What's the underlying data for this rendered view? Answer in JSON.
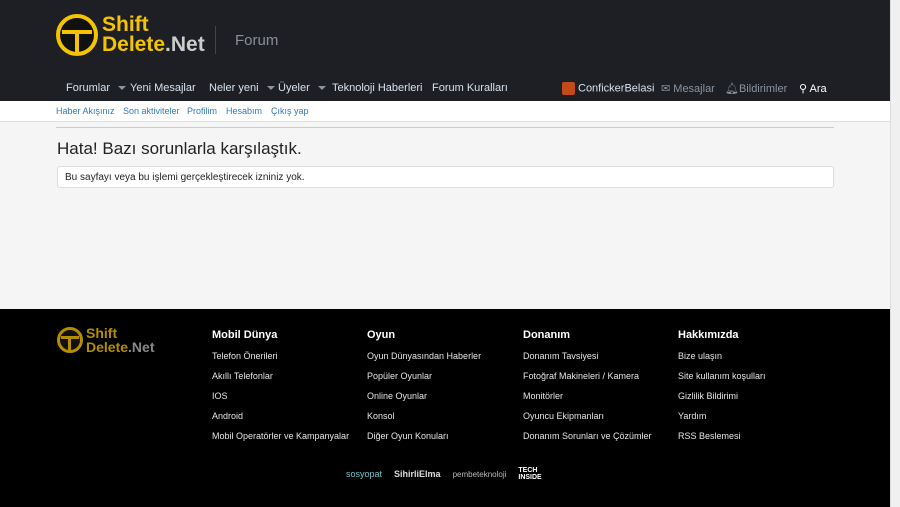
{
  "header": {
    "logo_line1": "Shift",
    "logo_line2": "Delete",
    "logo_line3": ".Net",
    "section": "Forum"
  },
  "nav": {
    "items": [
      {
        "label": "Forumlar"
      },
      {
        "label": "Yeni Mesajlar"
      },
      {
        "label": "Neler yeni"
      },
      {
        "label": "Üyeler"
      },
      {
        "label": "Teknoloji Haberleri"
      },
      {
        "label": "Forum Kuralları"
      }
    ],
    "user": "ConfickerBelasi",
    "messages": "Mesajlar",
    "alerts": "Bildirimler",
    "search": "Ara"
  },
  "subnav": [
    "Haber Akışınız",
    "Son aktiviteler",
    "Profilim",
    "Hesabım",
    "Çıkış yap"
  ],
  "main": {
    "title": "Hata! Bazı sorunlarla karşılaştık.",
    "error": "Bu sayfayı veya bu işlemi gerçekleştirecek izniniz yok."
  },
  "footer": {
    "columns": [
      {
        "title": "Mobil Dünya",
        "links": [
          "Telefon Önerileri",
          "Akıllı Telefonlar",
          "IOS",
          "Android",
          "Mobil Operatörler ve Kampanyalar"
        ]
      },
      {
        "title": "Oyun",
        "links": [
          "Oyun Dünyasından Haberler",
          "Popüler Oyunlar",
          "Online Oyunlar",
          "Konsol",
          "Diğer Oyun Konuları"
        ]
      },
      {
        "title": "Donanım",
        "links": [
          "Donanım Tavsiyesi",
          "Fotoğraf Makineleri / Kamera",
          "Monitörler",
          "Oyuncu Ekipmanları",
          "Donanım Sorunları ve Çözümler"
        ]
      },
      {
        "title": "Hakkımızda",
        "links": [
          "Bize ulaşın",
          "Site kullanım koşulları",
          "Gizlilik Bildirimi",
          "Yardım",
          "RSS Beslemesi"
        ]
      }
    ],
    "partners": [
      "sosyopat",
      "SihirliElma",
      "pembeteknoloji",
      "TECH INSIDE"
    ]
  },
  "colors": {
    "accent": "#f5c400",
    "header": "#1d1f24",
    "link": "#2f7abf"
  }
}
